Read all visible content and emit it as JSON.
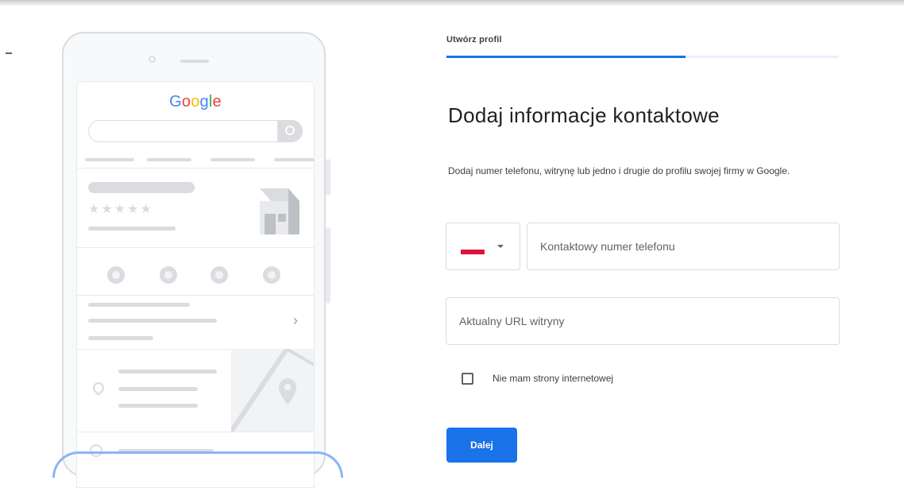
{
  "illustration": {
    "logo_letters": [
      {
        "char": "G",
        "color": "#4285F4"
      },
      {
        "char": "o",
        "color": "#EA4335"
      },
      {
        "char": "o",
        "color": "#FBBC05"
      },
      {
        "char": "g",
        "color": "#4285F4"
      },
      {
        "char": "l",
        "color": "#34A853"
      },
      {
        "char": "e",
        "color": "#EA4335"
      }
    ],
    "stars": "★★★★★",
    "chevron": "›"
  },
  "form": {
    "step_label": "Utwórz profil",
    "progress_fraction": 0.61,
    "heading": "Dodaj informacje kontaktowe",
    "description": "Dodaj numer telefonu, witrynę lub jedno i drugie do profilu swojej firmy w Google.",
    "country_select": {
      "flag_colors": [
        "#ffffff",
        "#dc143c"
      ]
    },
    "phone_placeholder": "Kontaktowy numer telefonu",
    "phone_value": "",
    "url_placeholder": "Aktualny URL witryny",
    "url_value": "",
    "no_website_checkbox": {
      "label": "Nie mam strony internetowej",
      "checked": false
    },
    "next_button": "Dalej"
  },
  "colors": {
    "accent": "#1a73e8",
    "border": "#dadce0",
    "illustration_gray": "#dadce0"
  }
}
